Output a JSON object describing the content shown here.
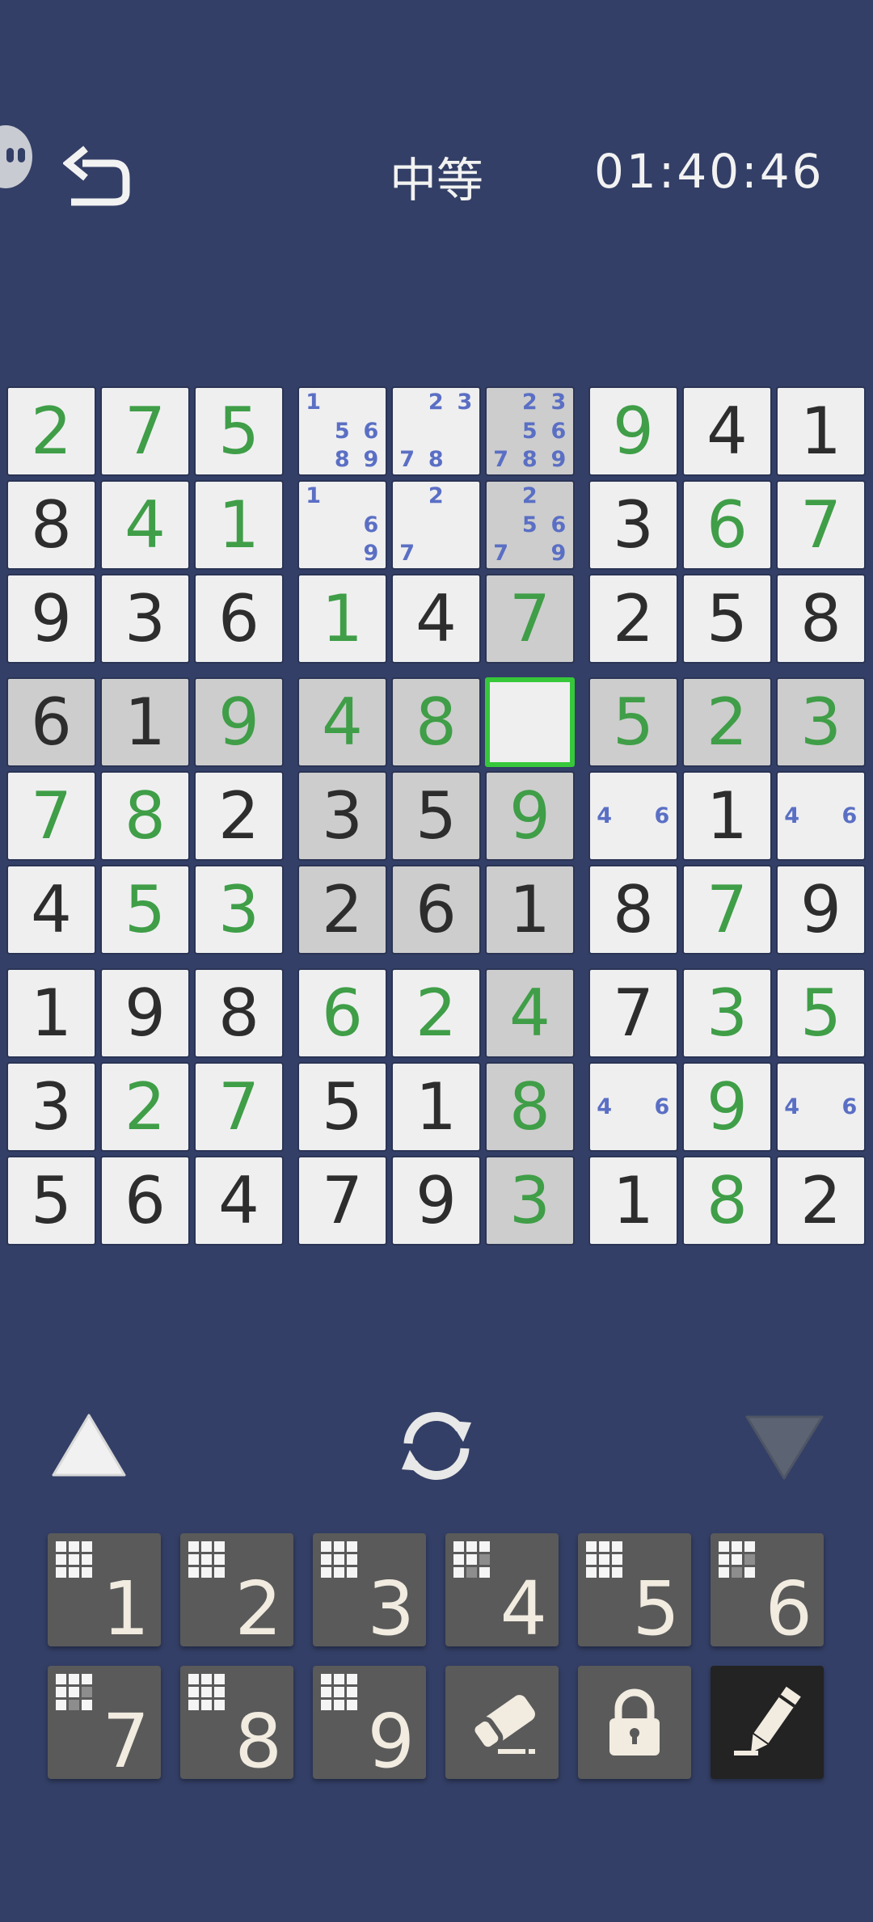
{
  "header": {
    "difficulty": "中等",
    "timer": "01:40:46"
  },
  "board": {
    "cells": [
      [
        {
          "v": "2",
          "t": "user"
        },
        {
          "v": "7",
          "t": "user"
        },
        {
          "v": "5",
          "t": "user"
        },
        {
          "notes": [
            "1",
            "5",
            "6",
            "8",
            "9"
          ]
        },
        {
          "notes": [
            "2",
            "3",
            "7",
            "8"
          ]
        },
        {
          "notes": [
            "2",
            "3",
            "5",
            "6",
            "7",
            "8",
            "9"
          ],
          "hl": true
        },
        {
          "v": "9",
          "t": "user"
        },
        {
          "v": "4",
          "t": "given"
        },
        {
          "v": "1",
          "t": "given"
        }
      ],
      [
        {
          "v": "8",
          "t": "given"
        },
        {
          "v": "4",
          "t": "user"
        },
        {
          "v": "1",
          "t": "user"
        },
        {
          "notes": [
            "1",
            "6",
            "9"
          ]
        },
        {
          "notes": [
            "2",
            "7"
          ]
        },
        {
          "notes": [
            "2",
            "5",
            "6",
            "7",
            "9"
          ],
          "hl": true
        },
        {
          "v": "3",
          "t": "given"
        },
        {
          "v": "6",
          "t": "user"
        },
        {
          "v": "7",
          "t": "user"
        }
      ],
      [
        {
          "v": "9",
          "t": "given"
        },
        {
          "v": "3",
          "t": "given"
        },
        {
          "v": "6",
          "t": "given"
        },
        {
          "v": "1",
          "t": "user"
        },
        {
          "v": "4",
          "t": "given"
        },
        {
          "v": "7",
          "t": "user",
          "hl": true
        },
        {
          "v": "2",
          "t": "given"
        },
        {
          "v": "5",
          "t": "given"
        },
        {
          "v": "8",
          "t": "given"
        }
      ],
      [
        {
          "v": "6",
          "t": "given",
          "hl": true
        },
        {
          "v": "1",
          "t": "given",
          "hl": true
        },
        {
          "v": "9",
          "t": "user",
          "hl": true
        },
        {
          "v": "4",
          "t": "user",
          "hl": true
        },
        {
          "v": "8",
          "t": "user",
          "hl": true
        },
        {
          "selected": true
        },
        {
          "v": "5",
          "t": "user",
          "hl": true
        },
        {
          "v": "2",
          "t": "user",
          "hl": true
        },
        {
          "v": "3",
          "t": "user",
          "hl": true
        }
      ],
      [
        {
          "v": "7",
          "t": "user"
        },
        {
          "v": "8",
          "t": "user"
        },
        {
          "v": "2",
          "t": "given"
        },
        {
          "v": "3",
          "t": "given",
          "hl": true
        },
        {
          "v": "5",
          "t": "given",
          "hl": true
        },
        {
          "v": "9",
          "t": "user",
          "hl": true
        },
        {
          "notes": [
            "4",
            "6"
          ]
        },
        {
          "v": "1",
          "t": "given"
        },
        {
          "notes": [
            "4",
            "6"
          ]
        }
      ],
      [
        {
          "v": "4",
          "t": "given"
        },
        {
          "v": "5",
          "t": "user"
        },
        {
          "v": "3",
          "t": "user"
        },
        {
          "v": "2",
          "t": "given",
          "hl": true
        },
        {
          "v": "6",
          "t": "given",
          "hl": true
        },
        {
          "v": "1",
          "t": "given",
          "hl": true
        },
        {
          "v": "8",
          "t": "given"
        },
        {
          "v": "7",
          "t": "user"
        },
        {
          "v": "9",
          "t": "given"
        }
      ],
      [
        {
          "v": "1",
          "t": "given"
        },
        {
          "v": "9",
          "t": "given"
        },
        {
          "v": "8",
          "t": "given"
        },
        {
          "v": "6",
          "t": "user"
        },
        {
          "v": "2",
          "t": "user"
        },
        {
          "v": "4",
          "t": "user",
          "hl": true
        },
        {
          "v": "7",
          "t": "given"
        },
        {
          "v": "3",
          "t": "user"
        },
        {
          "v": "5",
          "t": "user"
        }
      ],
      [
        {
          "v": "3",
          "t": "given"
        },
        {
          "v": "2",
          "t": "user"
        },
        {
          "v": "7",
          "t": "user"
        },
        {
          "v": "5",
          "t": "given"
        },
        {
          "v": "1",
          "t": "given"
        },
        {
          "v": "8",
          "t": "user",
          "hl": true
        },
        {
          "notes": [
            "4",
            "6"
          ]
        },
        {
          "v": "9",
          "t": "user"
        },
        {
          "notes": [
            "4",
            "6"
          ]
        }
      ],
      [
        {
          "v": "5",
          "t": "given"
        },
        {
          "v": "6",
          "t": "given"
        },
        {
          "v": "4",
          "t": "given"
        },
        {
          "v": "7",
          "t": "given"
        },
        {
          "v": "9",
          "t": "given"
        },
        {
          "v": "3",
          "t": "user",
          "hl": true
        },
        {
          "v": "1",
          "t": "given"
        },
        {
          "v": "8",
          "t": "user"
        },
        {
          "v": "2",
          "t": "given"
        }
      ]
    ]
  },
  "controls": {
    "icons": [
      "triangle-up-icon",
      "refresh-icon",
      "triangle-down-icon"
    ]
  },
  "keypad": {
    "digits": [
      "1",
      "2",
      "3",
      "4",
      "5",
      "6",
      "7",
      "8",
      "9"
    ],
    "digit_progress": [
      {
        "digit": "1",
        "done": true
      },
      {
        "digit": "2",
        "done": true
      },
      {
        "digit": "3",
        "done": true
      },
      {
        "digit": "4",
        "done": false
      },
      {
        "digit": "5",
        "done": true
      },
      {
        "digit": "6",
        "done": false
      },
      {
        "digit": "7",
        "done": false
      },
      {
        "digit": "8",
        "done": true
      },
      {
        "digit": "9",
        "done": true
      }
    ],
    "tools": [
      {
        "name": "eraser",
        "icon": "eraser-icon"
      },
      {
        "name": "lock",
        "icon": "lock-icon"
      },
      {
        "name": "pencil",
        "icon": "pencil-icon",
        "active": true
      }
    ]
  },
  "colors": {
    "background": "#333f66",
    "cell": "#efeff0",
    "highlight": "#cdcdcd",
    "given_digit": "#2d2d2d",
    "user_digit": "#3f9e47",
    "note_digit": "#5a6fc4",
    "selection": "#36c83a",
    "key": "#5a5a5a",
    "key_active": "#232323"
  }
}
